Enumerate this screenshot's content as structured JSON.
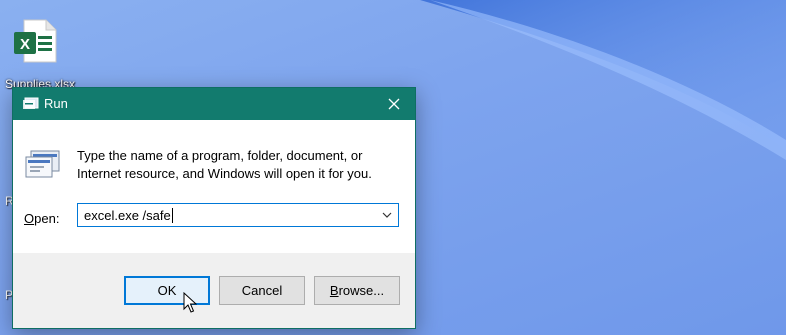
{
  "desktop": {
    "icons": [
      {
        "label": "Supplies.xlsx",
        "icon": "excel-file-icon"
      }
    ],
    "partial_icon_labels": [
      "R",
      "P"
    ]
  },
  "run_dialog": {
    "title": "Run",
    "title_icon": "run-icon",
    "close_icon": "close-icon",
    "description": "Type the name of a program, folder, document, or Internet resource, and Windows will open it for you.",
    "open_label_mnemonic": "O",
    "open_label_rest": "pen:",
    "open_value": "excel.exe /safe",
    "buttons": {
      "ok": "OK",
      "cancel": "Cancel",
      "browse_mnemonic": "B",
      "browse_rest": "rowse..."
    },
    "colors": {
      "titlebar": "#127b6e",
      "focus_border": "#0078d7"
    }
  }
}
